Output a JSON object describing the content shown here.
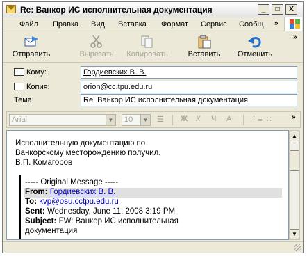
{
  "window": {
    "title": "Re: Ванкор ИС  исполнительная документация",
    "minimize": "_",
    "maximize": "□",
    "close": "X"
  },
  "menu": {
    "items": [
      "Файл",
      "Правка",
      "Вид",
      "Вставка",
      "Формат",
      "Сервис",
      "Сообщ"
    ],
    "overflow": "»"
  },
  "toolbar": {
    "send": "Отправить",
    "cut": "Вырезать",
    "copy": "Копировать",
    "paste": "Вставить",
    "undo": "Отменить",
    "overflow": "»"
  },
  "header": {
    "to_label": "Кому:",
    "to_value": "Гордиевских В. В.",
    "cc_label": "Копия:",
    "cc_value": "orion@cc.tpu.edu.ru",
    "subject_label": "Тема:",
    "subject_value": "Re: Ванкор ИС  исполнительная документация"
  },
  "format": {
    "font": "Arial",
    "size": "10",
    "overflow": "»"
  },
  "body": {
    "line1": "Исполнительную документацию по",
    "line2": "Ванкорскому месторождению получил.",
    "line3": "В.П. Комагоров",
    "original_header": "----- Original Message -----",
    "from_label": "From:",
    "from_value": "Гордиевских В. В.",
    "to_label": "To:",
    "to_value": "kvp@osu.cctpu.edu.ru",
    "sent_label": "Sent:",
    "sent_value": "Wednesday, June 11, 2008 3:19 PM",
    "subject_label": "Subject:",
    "subject_value": "FW: Ванкор ИС исполнительная",
    "subject_cont": "документация"
  },
  "colors": {
    "link": "#0000cc",
    "chrome": "#ece9d8"
  }
}
